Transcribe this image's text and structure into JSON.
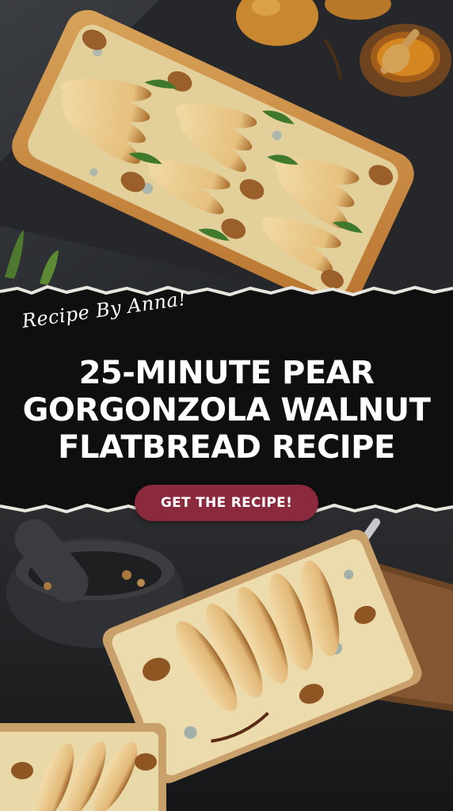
{
  "banner": {
    "script_text": "Recipe By Anna!",
    "title_lines": [
      "25-MINUTE PEAR",
      "GORGONZOLA WALNUT",
      "FLATBREAD RECIPE"
    ],
    "cta_label": "GET THE RECIPE!"
  },
  "colors": {
    "banner_bg": "#0f0f10",
    "cta_bg": "#8a2a3c",
    "text": "#ffffff"
  }
}
